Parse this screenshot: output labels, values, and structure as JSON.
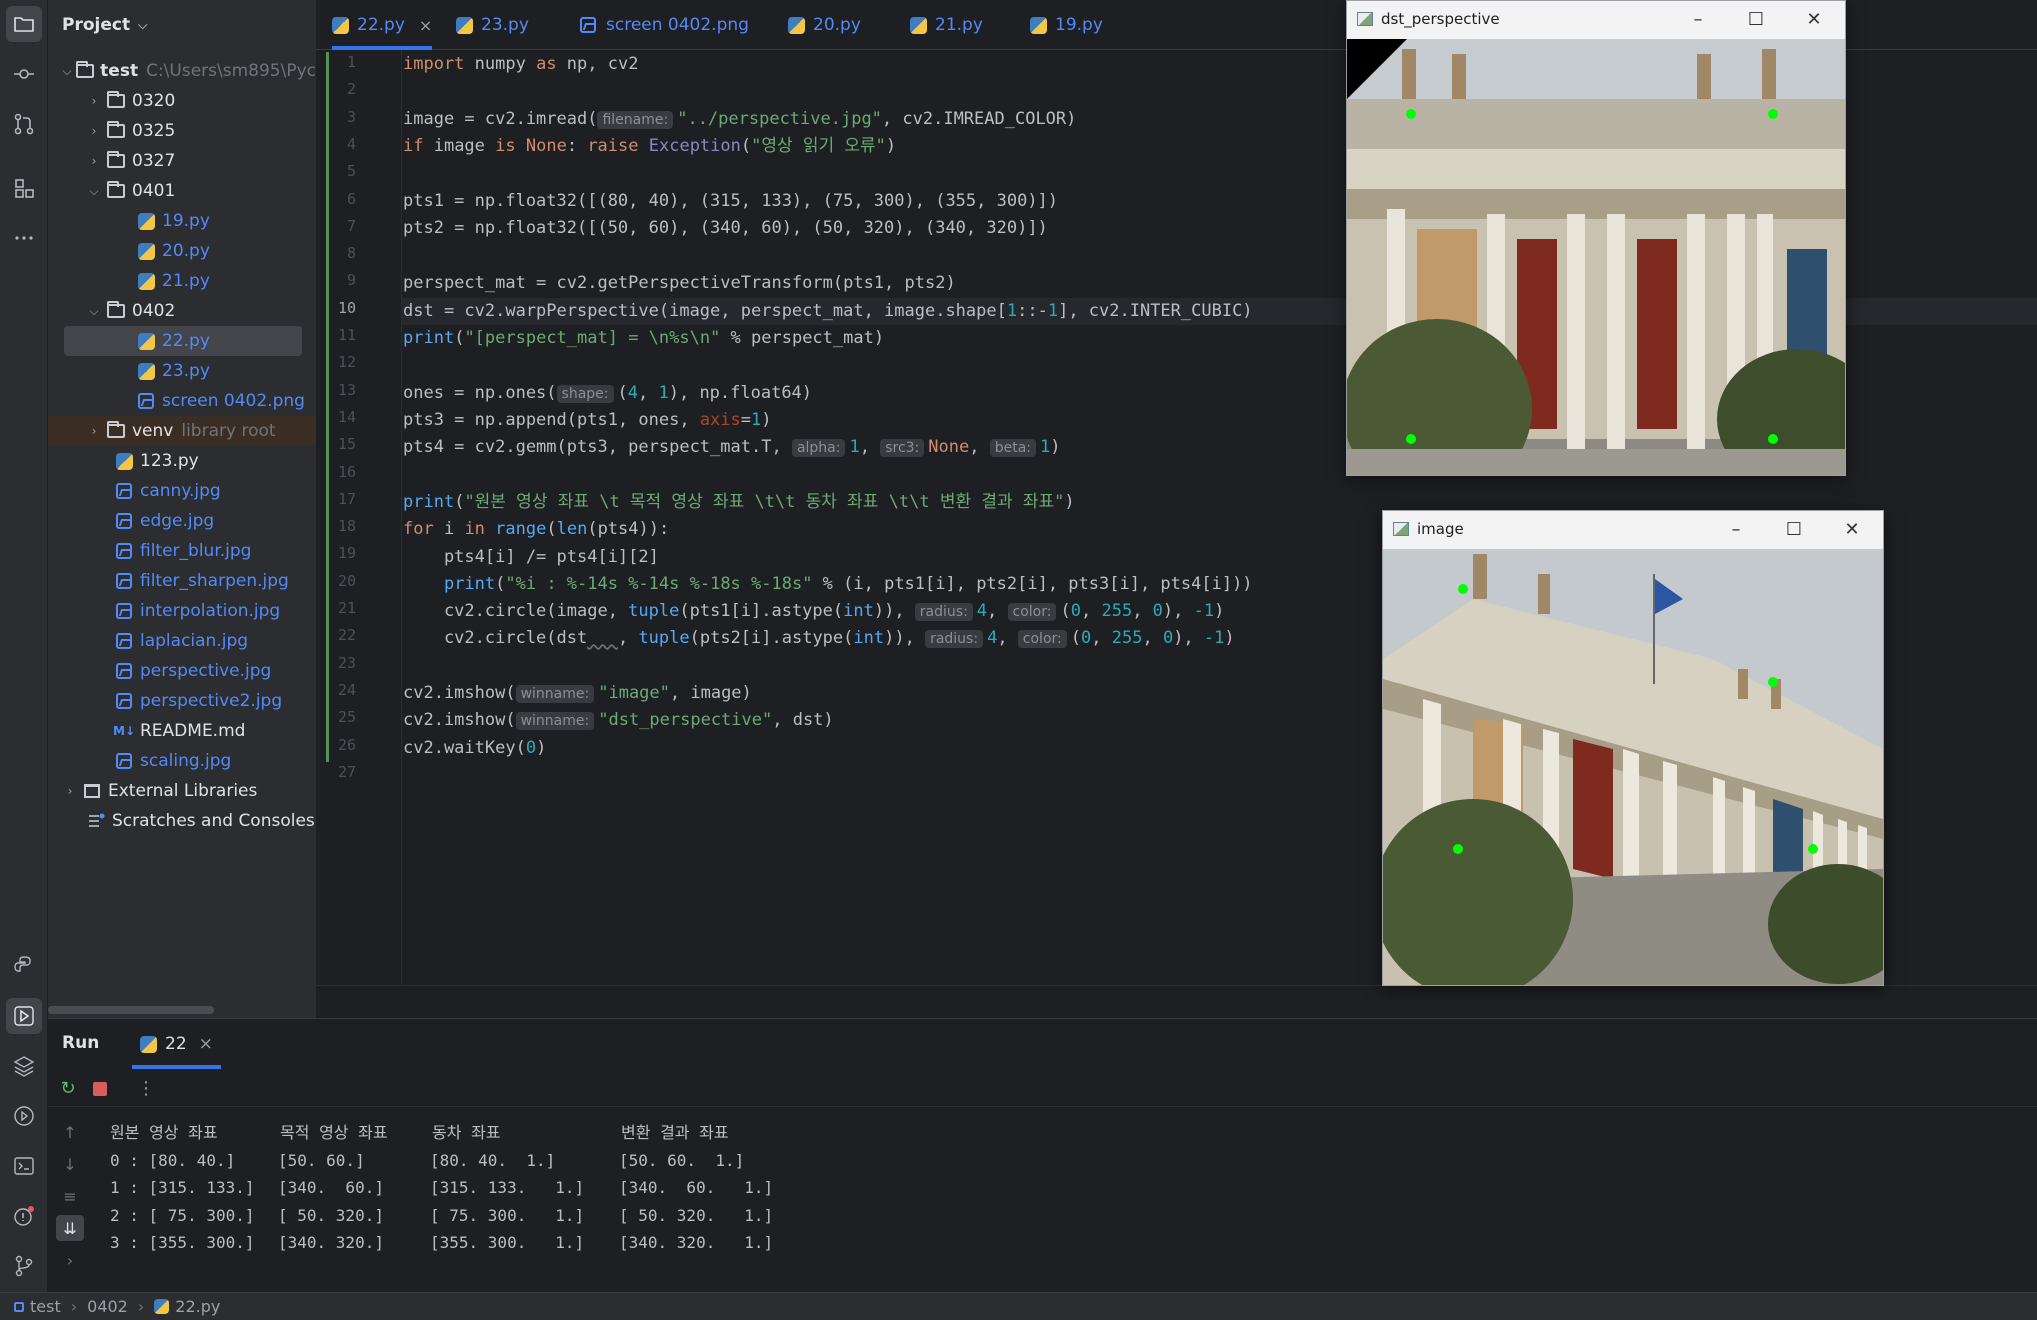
{
  "project_panel": {
    "title": "Project",
    "items": [
      {
        "label": "test",
        "dim": "C:\\Users\\sm895\\Pyc",
        "kind": "folder"
      },
      {
        "label": "0320",
        "kind": "folder"
      },
      {
        "label": "0325",
        "kind": "folder"
      },
      {
        "label": "0327",
        "kind": "folder"
      },
      {
        "label": "0401",
        "kind": "folder"
      },
      {
        "label": "19.py",
        "kind": "py"
      },
      {
        "label": "20.py",
        "kind": "py"
      },
      {
        "label": "21.py",
        "kind": "py"
      },
      {
        "label": "0402",
        "kind": "folder"
      },
      {
        "label": "22.py",
        "kind": "py"
      },
      {
        "label": "23.py",
        "kind": "py"
      },
      {
        "label": "screen 0402.png",
        "kind": "img"
      },
      {
        "label": "venv",
        "dim": "library root",
        "kind": "folder"
      },
      {
        "label": "123.py",
        "kind": "py"
      },
      {
        "label": "canny.jpg",
        "kind": "img"
      },
      {
        "label": "edge.jpg",
        "kind": "img"
      },
      {
        "label": "filter_blur.jpg",
        "kind": "img"
      },
      {
        "label": "filter_sharpen.jpg",
        "kind": "img"
      },
      {
        "label": "interpolation.jpg",
        "kind": "img"
      },
      {
        "label": "laplacian.jpg",
        "kind": "img"
      },
      {
        "label": "perspective.jpg",
        "kind": "img"
      },
      {
        "label": "perspective2.jpg",
        "kind": "img"
      },
      {
        "label": "README.md",
        "kind": "md"
      },
      {
        "label": "scaling.jpg",
        "kind": "img"
      },
      {
        "label": "External Libraries",
        "kind": "lib"
      },
      {
        "label": "Scratches and Consoles",
        "kind": "scratch"
      }
    ]
  },
  "tabs": [
    {
      "label": "22.py",
      "active": true
    },
    {
      "label": "23.py"
    },
    {
      "label": "screen 0402.png"
    },
    {
      "label": "20.py"
    },
    {
      "label": "21.py"
    },
    {
      "label": "19.py"
    }
  ],
  "editor": {
    "line_numbers": [
      "1",
      "2",
      "3",
      "4",
      "5",
      "6",
      "7",
      "8",
      "9",
      "10",
      "11",
      "12",
      "13",
      "14",
      "15",
      "16",
      "17",
      "18",
      "19",
      "20",
      "21",
      "22",
      "23",
      "24",
      "25",
      "26",
      "27"
    ],
    "current_line": "10",
    "lines": {
      "l1a": "import",
      "l1b": " numpy ",
      "l1c": "as",
      "l1d": " np, cv2",
      "l3a": "image = cv2.imread(",
      "l3h": "filename:",
      "l3s": "\"../perspective.jpg\"",
      "l3b": ", cv2.IMREAD_COLOR)",
      "l4a": "if",
      "l4b": " image ",
      "l4c": "is",
      "l4d": " ",
      "l4e": "None",
      "l4f": ": ",
      "l4g": "raise",
      "l4h": " ",
      "l4i": "Exception",
      "l4j": "(",
      "l4s": "\"영상 읽기 오류\"",
      "l4k": ")",
      "l6": "pts1 = np.float32([(80, 40), (315, 133), (75, 300), (355, 300)])",
      "l7": "pts2 = np.float32([(50, 60), (340, 60), (50, 320), (340, 320)])",
      "l9": "perspect_mat = cv2.getPerspectiveTransform(pts1, pts2)",
      "l10a": "dst = cv2.warpPerspective(image, perspect_mat, image.shape[",
      "l10b": "1",
      "l10c": "::-",
      "l10d": "1",
      "l10e": "], cv2.INTER_CUBIC)",
      "l11a": "print",
      "l11b": "(",
      "l11s": "\"[perspect_mat] = \\n%s\\n\"",
      "l11c": " % perspect_mat)",
      "l13a": "ones = np.ones(",
      "l13h": "shape:",
      "l13b": "(",
      "l13n1": "4",
      "l13c": ", ",
      "l13n2": "1",
      "l13d": "), np.float64)",
      "l14a": "pts3 = np.append(pts1, ones, ",
      "l14k": "axis",
      "l14b": "=",
      "l14n": "1",
      "l14c": ")",
      "l15a": "pts4 = cv2.gemm(pts3, perspect_mat.T, ",
      "l15h1": "alpha:",
      "l15n1": "1",
      "l15c": ", ",
      "l15h2": "src3:",
      "l15k": "None",
      "l15d": ", ",
      "l15h3": "beta:",
      "l15n2": "1",
      "l15e": ")",
      "l17a": "print",
      "l17b": "(",
      "l17s": "\"원본 영상 좌표 \\t 목적 영상 좌표 \\t\\t 동차 좌표 \\t\\t 변환 결과 좌표\"",
      "l17c": ")",
      "l18a": "for",
      "l18b": " i ",
      "l18c": "in",
      "l18d": " ",
      "l18e": "range",
      "l18f": "(",
      "l18g": "len",
      "l18h": "(pts4)):",
      "l19": "    pts4[i] /= pts4[i][2]",
      "l20a": "    ",
      "l20b": "print",
      "l20c": "(",
      "l20s": "\"%i : %-14s %-14s %-18s %-18s\"",
      "l20d": " % (i, pts1[i], pts2[i], pts3[i], pts4[i]))",
      "l21a": "    cv2.circle(image, ",
      "l21b": "tuple",
      "l21c": "(pts1[i].astype(",
      "l21d": "int",
      "l21e": ")), ",
      "l21h1": "radius:",
      "l21n1": "4",
      "l21f": ", ",
      "l21h2": "color:",
      "l21g": "(",
      "l21n2": "0",
      "l21i": ", ",
      "l21n3": "255",
      "l21j": ", ",
      "l21n4": "0",
      "l21k": "), ",
      "l21n5": "-1",
      "l21l": ")",
      "l22a": "    cv2.circle(dst",
      "l22u": "   ",
      "l22a2": ", ",
      "l22b": "tuple",
      "l22c": "(pts2[i].astype(",
      "l22d": "int",
      "l22e": ")), ",
      "l22h1": "radius:",
      "l22n1": "4",
      "l22f": ", ",
      "l22h2": "color:",
      "l22g": "(",
      "l22n2": "0",
      "l22i": ", ",
      "l22n3": "255",
      "l22j": ", ",
      "l22n4": "0",
      "l22k": "), ",
      "l22n5": "-1",
      "l22l": ")",
      "l24a": "cv2.imshow(",
      "l24h": "winname:",
      "l24s": "\"image\"",
      "l24b": ", image)",
      "l25a": "cv2.imshow(",
      "l25h": "winname:",
      "l25s": "\"dst_perspective\"",
      "l25b": ", dst)",
      "l26a": "cv2.waitKey(",
      "l26n": "0",
      "l26b": ")"
    }
  },
  "windows": {
    "dst": {
      "title": "dst_perspective"
    },
    "image": {
      "title": "image"
    }
  },
  "run": {
    "label": "Run",
    "tab_label": "22",
    "output": [
      [
        "원본 영상 좌표",
        "목적 영상 좌표",
        "동차 좌표",
        "변환 결과 좌표"
      ],
      [
        "0 : [80. 40.]",
        "[50. 60.]",
        "[80. 40.  1.]",
        "[50. 60.  1.]"
      ],
      [
        "1 : [315. 133.]",
        "[340.  60.]",
        "[315. 133.   1.]",
        "[340.  60.   1.]"
      ],
      [
        "2 : [ 75. 300.]",
        "[ 50. 320.]",
        "[ 75. 300.   1.]",
        "[ 50. 320.   1.]"
      ],
      [
        "3 : [355. 300.]",
        "[340. 320.]",
        "[355. 300.   1.]",
        "[340. 320.   1.]"
      ]
    ]
  },
  "statusbar": {
    "crumbs": [
      "test",
      "0402",
      "22.py"
    ]
  },
  "colors": {
    "accent": "#3574f0",
    "file_blue": "#548af7",
    "keyword": "#cf8e6d",
    "string": "#6aab73",
    "number": "#2aacb8",
    "marker_green": "#00ff00"
  }
}
